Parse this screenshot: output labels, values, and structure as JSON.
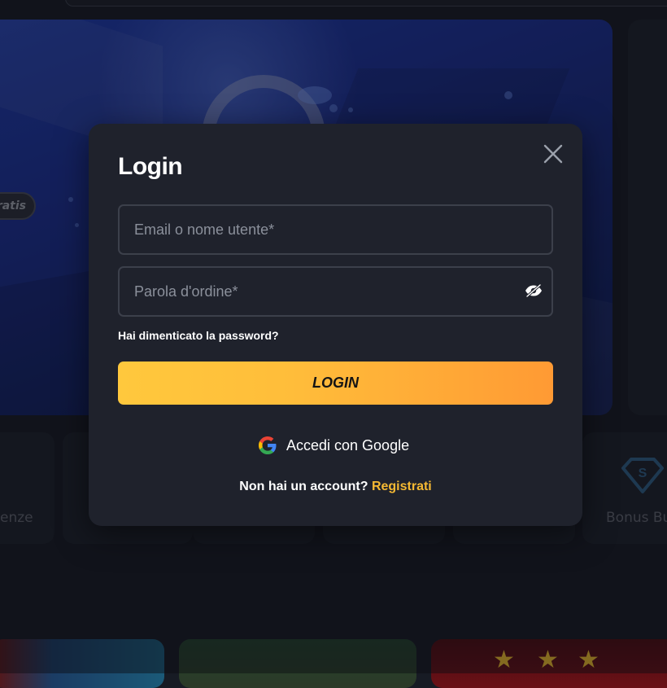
{
  "modal": {
    "title": "Login",
    "email_placeholder": "Email o nome utente*",
    "password_placeholder": "Parola d'ordine*",
    "forgot_password": "Hai dimenticato la password?",
    "login_button": "LOGIN",
    "google_button": "Accedi con Google",
    "no_account_text": "Non hai un account?",
    "register_link": "Registrati"
  },
  "background": {
    "hero_tag": "ratis",
    "categories": [
      {
        "label": "enze",
        "icon": "flame-icon"
      },
      {
        "label": "Bonus Bu",
        "icon": "diamond-s-icon"
      }
    ]
  },
  "colors": {
    "modal_bg": "#1f222c",
    "login_gradient_start": "#ffc83d",
    "login_gradient_end": "#ff9a34",
    "link_accent": "#f5b933"
  }
}
